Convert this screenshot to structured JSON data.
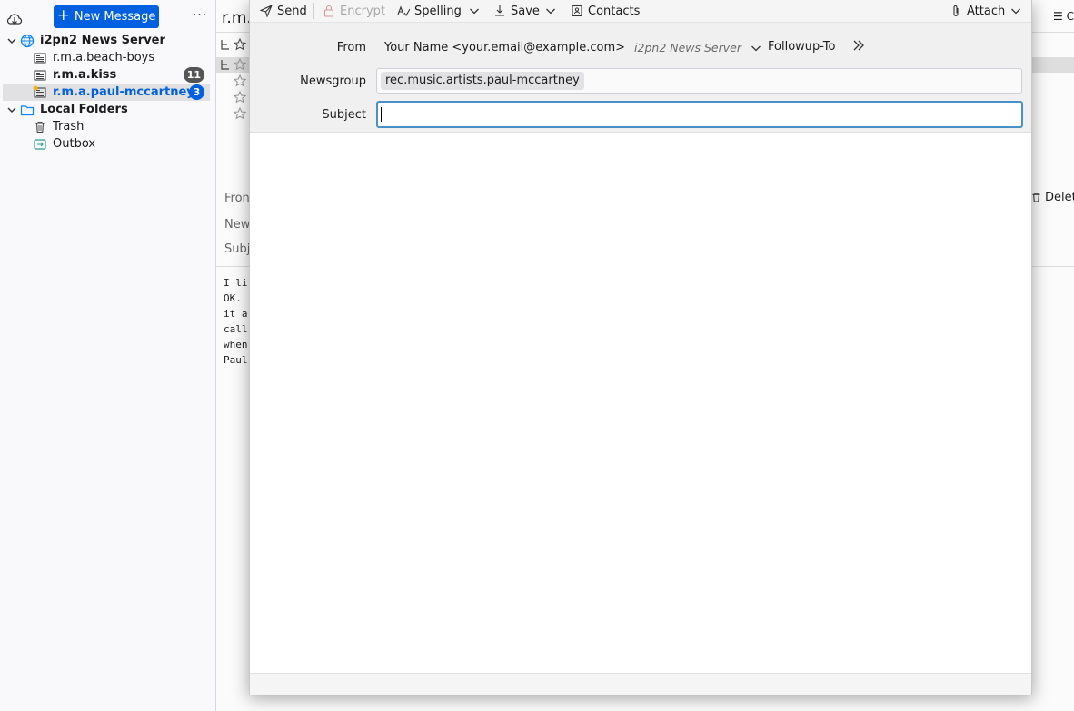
{
  "folder_pane": {
    "new_message_label": "New Message",
    "menu_label": "···",
    "accounts": [
      {
        "label": "i2pn2 News Server",
        "type": "news-server",
        "folders": [
          {
            "label": "r.m.a.beach-boys",
            "unread": ""
          },
          {
            "label": "r.m.a.kiss",
            "unread": "11"
          },
          {
            "label": "r.m.a.paul-mccartney",
            "unread": "3"
          }
        ]
      },
      {
        "label": "Local Folders",
        "type": "local",
        "folders": [
          {
            "label": "Trash"
          },
          {
            "label": "Outbox"
          }
        ]
      }
    ]
  },
  "background_window": {
    "title": "r.m.",
    "header_labels": [
      "Fron",
      "New",
      "Subj"
    ],
    "delete_label": "Delet",
    "toolbar_right": "C",
    "body_lines": [
      "I li",
      "OK.",
      "it a",
      "call",
      "when",
      "Paul"
    ]
  },
  "compose": {
    "toolbar": {
      "send": "Send",
      "encrypt": "Encrypt",
      "spelling": "Spelling",
      "save": "Save",
      "contacts": "Contacts",
      "attach": "Attach"
    },
    "from_label": "From",
    "from_value": "Your Name <your.email@example.com>",
    "from_identity": "i2pn2 News Server",
    "followup_label": "Followup-To",
    "newsgroup_label": "Newsgroup",
    "newsgroup_value": "rec.music.artists.paul-mccartney",
    "subject_label": "Subject",
    "subject_value": ""
  },
  "colors": {
    "accent": "#0060df",
    "badge_gray": "#555555",
    "focus_border": "#4a90c8"
  }
}
